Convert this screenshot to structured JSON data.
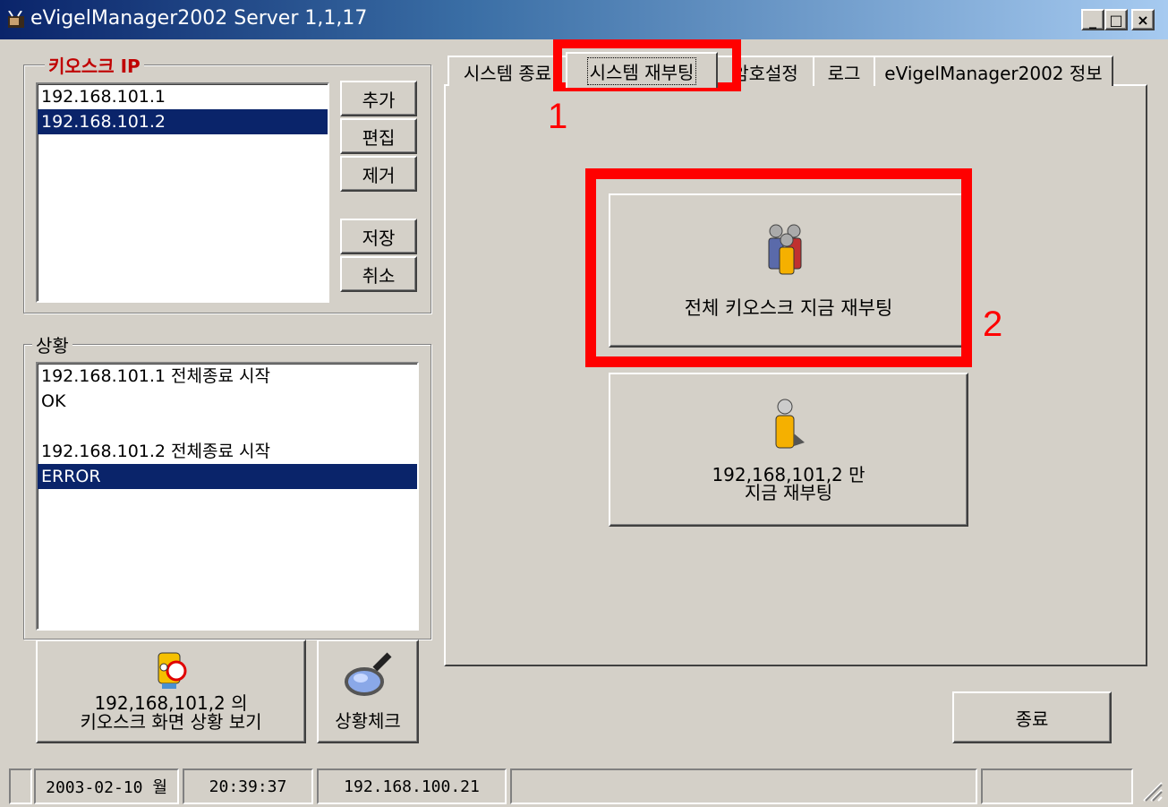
{
  "window": {
    "title": "eVigelManager2002 Server 1,1,17",
    "controls": {
      "minimize": "_",
      "maximize": "□",
      "close": "×"
    }
  },
  "kiosk_ip": {
    "legend": "키오스크 IP",
    "items": [
      "192.168.101.1",
      "192.168.101.2"
    ],
    "selected_index": 1,
    "buttons": {
      "add": "추가",
      "edit": "편집",
      "remove": "제거",
      "save": "저장",
      "cancel": "취소"
    }
  },
  "status_group": {
    "legend": "상황",
    "lines": [
      "192.168.101.1 전체종료 시작",
      "OK",
      "",
      "192.168.101.2 전체종료 시작",
      "ERROR"
    ],
    "selected_index": 4
  },
  "bottom_buttons": {
    "view_screen": [
      "192,168,101,2 의",
      "키오스크 화면 상황 보기"
    ],
    "status_check": "상황체크"
  },
  "tabs": [
    {
      "label": "시스템 종료",
      "active": false
    },
    {
      "label": "시스템 재부팅",
      "active": true
    },
    {
      "label": "암호설정",
      "active": false
    },
    {
      "label": "로그",
      "active": false
    },
    {
      "label": "eVigelManager2002 정보",
      "active": false
    }
  ],
  "reboot_panel": {
    "reboot_all_label": "전체 키오스크 지금 재부팅",
    "reboot_one_label": [
      "192,168,101,2 만",
      "지금 재부팅"
    ]
  },
  "exit_button": "종료",
  "statusbar": {
    "date": "2003-02-10 월",
    "time": "20:39:37",
    "ip": "192.168.100.21"
  },
  "annotations": {
    "label_1": "1",
    "label_2": "2",
    "color": "#ff0000"
  },
  "icons": {
    "app": "tv-icon",
    "group_people": "people-group-icon",
    "single_person": "person-icon",
    "viewer": "character-magnifier-icon",
    "search": "magnifying-glass-icon"
  }
}
